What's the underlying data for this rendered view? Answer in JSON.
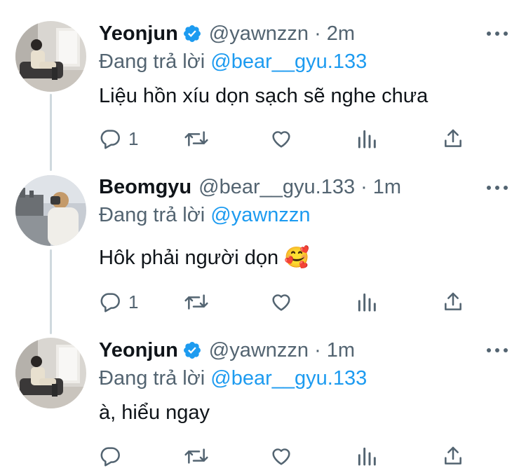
{
  "tweets": [
    {
      "name": "Yeonjun",
      "verified": true,
      "handle": "@yawnzzn",
      "dot": "·",
      "time": "2m",
      "reply_prefix": "Đang trả lời",
      "reply_mention": "@bear__gyu.133",
      "text": "Liệu hồn xíu dọn sạch sẽ nghe chưa",
      "reply_count": "1"
    },
    {
      "name": "Beomgyu",
      "verified": false,
      "handle": "@bear__gyu.133",
      "dot": "·",
      "time": "1m",
      "reply_prefix": "Đang trả lời",
      "reply_mention": "@yawnzzn",
      "text": "Hôk phải người dọn 🥰",
      "reply_count": "1"
    },
    {
      "name": "Yeonjun",
      "verified": true,
      "handle": "@yawnzzn",
      "dot": "·",
      "time": "1m",
      "reply_prefix": "Đang trả lời",
      "reply_mention": "@bear__gyu.133",
      "text": "à, hiểu ngay",
      "reply_count": ""
    }
  ],
  "colors": {
    "verified": "#1d9bf0",
    "mention": "#1d9bf0",
    "secondary_text": "#536471",
    "thread_line": "#cfd9de"
  },
  "icons": [
    "reply-icon",
    "retweet-icon",
    "like-icon",
    "views-icon",
    "share-icon",
    "more-icon",
    "verified-badge-icon"
  ]
}
